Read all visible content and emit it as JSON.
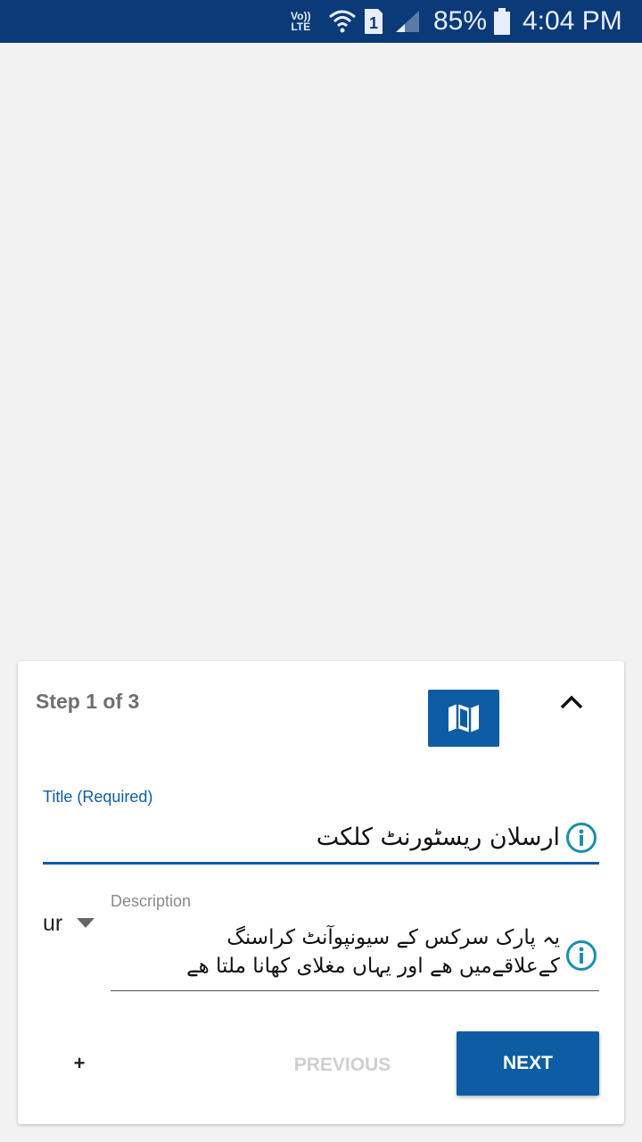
{
  "status_bar": {
    "volte_top": "Vo))",
    "volte_bottom": "LTE",
    "sim_number": "1",
    "battery_percent": "85%",
    "time": "4:04 PM"
  },
  "card": {
    "step_label": "Step 1 of 3",
    "map_icon": "map-icon",
    "collapse_icon": "chevron-up-icon",
    "title_field": {
      "label": "Title (Required)",
      "value": "ارسلان ریسٹورنٹ کلکت"
    },
    "description_field": {
      "label": "Description",
      "language": "ur",
      "line_1": "یہ پارک سرکس کے سیونپوآنٹ کراسنگ",
      "line_2": "کےعلاقےمیں ھے اور یہاں مغلای کھانا ملتا ھے"
    },
    "buttons": {
      "add": "+",
      "previous": "PREVIOUS",
      "next": "NEXT"
    }
  },
  "colors": {
    "status_bar": "#0a3a78",
    "accent": "#0e5da4",
    "info_icon": "#1a8fb0"
  }
}
